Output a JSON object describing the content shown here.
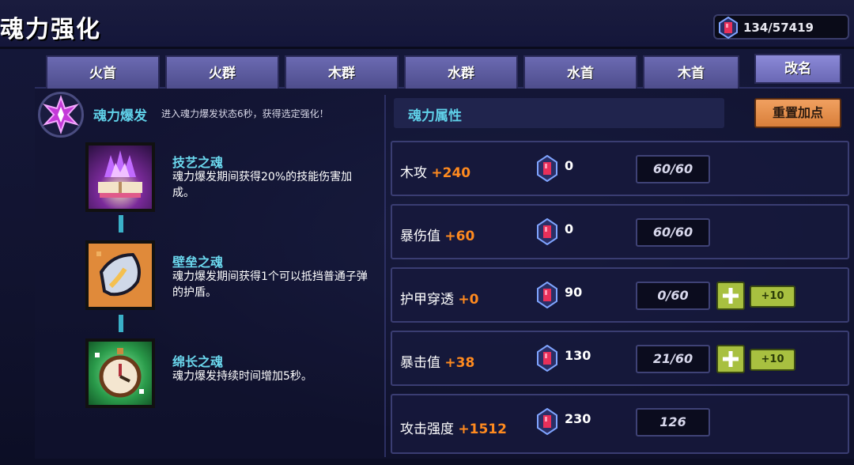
{
  "header": {
    "title": "魂力强化",
    "currency_value": "134/57419"
  },
  "tabs": [
    {
      "label": "火首"
    },
    {
      "label": "火群"
    },
    {
      "label": "木群"
    },
    {
      "label": "水群"
    },
    {
      "label": "水首"
    },
    {
      "label": "木首"
    }
  ],
  "rename_label": "改名",
  "burst": {
    "title": "魂力爆发",
    "desc": "进入魂力爆发状态6秒，获得选定强化！"
  },
  "skills": [
    {
      "name": "技艺之魂",
      "desc": "魂力爆发期间获得20%的技能伤害加成。",
      "icon": "purple-flame-book-icon"
    },
    {
      "name": "壁垒之魂",
      "desc": "魂力爆发期间获得1个可以抵挡普通子弹的护盾。",
      "icon": "shield-icon"
    },
    {
      "name": "绵长之魂",
      "desc": "魂力爆发持续时间增加5秒。",
      "icon": "clock-icon"
    }
  ],
  "attributes": {
    "header": "魂力属性",
    "reset_label": "重置加点",
    "rows": [
      {
        "name": "木攻",
        "bonus": "+240",
        "cost": "0",
        "progress": "60/60",
        "show_add": false
      },
      {
        "name": "暴伤值",
        "bonus": "+60",
        "cost": "0",
        "progress": "60/60",
        "show_add": false
      },
      {
        "name": "护甲穿透",
        "bonus": "+0",
        "cost": "90",
        "progress": "0/60",
        "show_add": true,
        "add10_label": "+10"
      },
      {
        "name": "暴击值",
        "bonus": "+38",
        "cost": "130",
        "progress": "21/60",
        "show_add": true,
        "add10_label": "+10"
      },
      {
        "name": "攻击强度",
        "bonus": "+1512",
        "cost": "230",
        "progress": "126",
        "show_add": false
      }
    ]
  },
  "colors": {
    "accent_cyan": "#5fd0e8",
    "bonus_orange": "#ff8a1f",
    "reset_orange": "#d97f3a",
    "add_green": "#a8c040"
  }
}
